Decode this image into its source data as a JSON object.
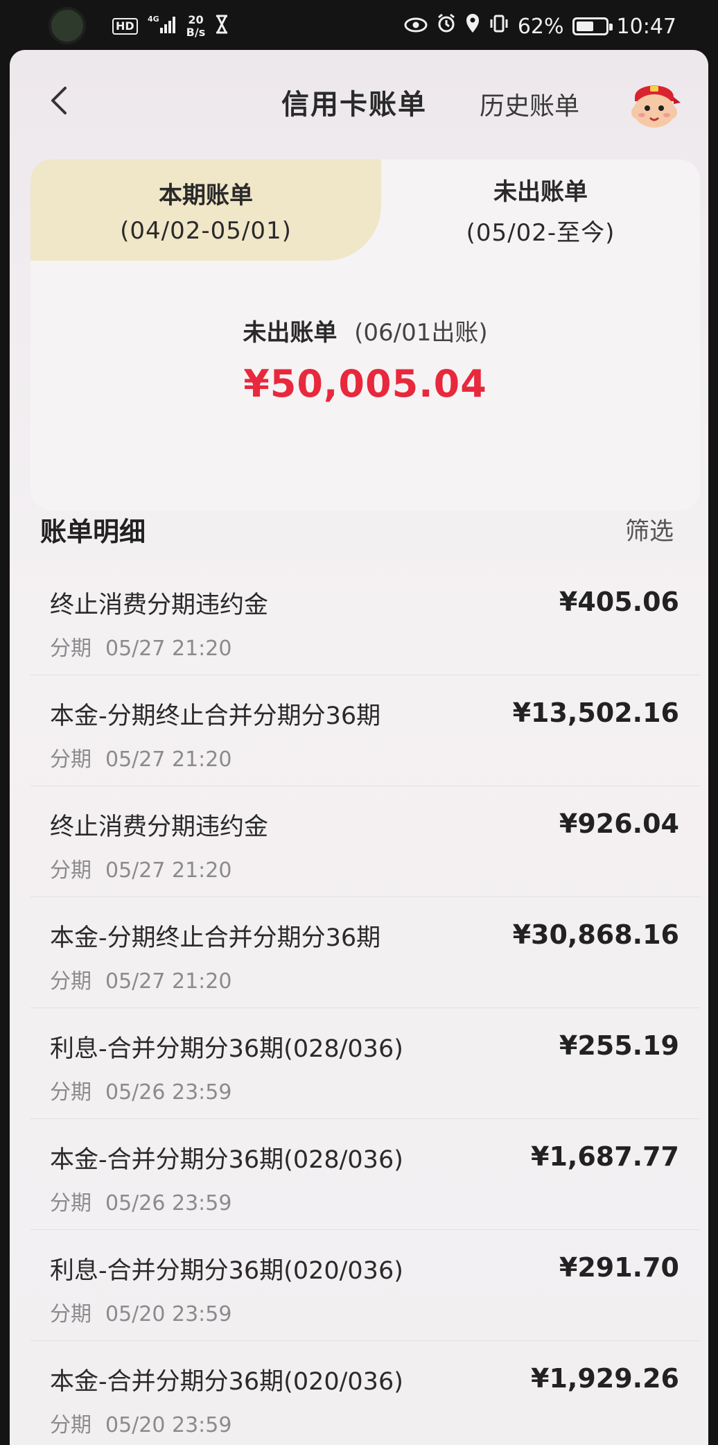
{
  "status_bar": {
    "hd": "HD",
    "network": "4G",
    "net_speed_value": "20",
    "net_speed_unit": "B/s",
    "battery": "62%",
    "battery_level": 0.62,
    "time": "10:47"
  },
  "nav": {
    "title": "信用卡账单",
    "history": "历史账单"
  },
  "tabs": [
    {
      "label": "本期账单",
      "range": "(04/02-05/01)",
      "active": true
    },
    {
      "label": "未出账单",
      "range": "(05/02-至今)",
      "active": false
    }
  ],
  "summary": {
    "label": "未出账单",
    "statement_date": "(06/01出账)",
    "amount": "¥50,005.04"
  },
  "details": {
    "title": "账单明细",
    "filter": "筛选"
  },
  "transactions": [
    {
      "desc": "终止消费分期违约金",
      "category": "分期",
      "time": "05/27 21:20",
      "amount": "¥405.06"
    },
    {
      "desc": "本金-分期终止合并分期分36期",
      "category": "分期",
      "time": "05/27 21:20",
      "amount": "¥13,502.16"
    },
    {
      "desc": "终止消费分期违约金",
      "category": "分期",
      "time": "05/27 21:20",
      "amount": "¥926.04"
    },
    {
      "desc": "本金-分期终止合并分期分36期",
      "category": "分期",
      "time": "05/27 21:20",
      "amount": "¥30,868.16"
    },
    {
      "desc": "利息-合并分期分36期(028/036)",
      "category": "分期",
      "time": "05/26 23:59",
      "amount": "¥255.19"
    },
    {
      "desc": "本金-合并分期分36期(028/036)",
      "category": "分期",
      "time": "05/26 23:59",
      "amount": "¥1,687.77"
    },
    {
      "desc": "利息-合并分期分36期(020/036)",
      "category": "分期",
      "time": "05/20 23:59",
      "amount": "¥291.70"
    },
    {
      "desc": "本金-合并分期分36期(020/036)",
      "category": "分期",
      "time": "05/20 23:59",
      "amount": "¥1,929.26"
    }
  ],
  "colors": {
    "accent_red": "#e8283c",
    "active_tab_bg": "#f0e6c8"
  }
}
